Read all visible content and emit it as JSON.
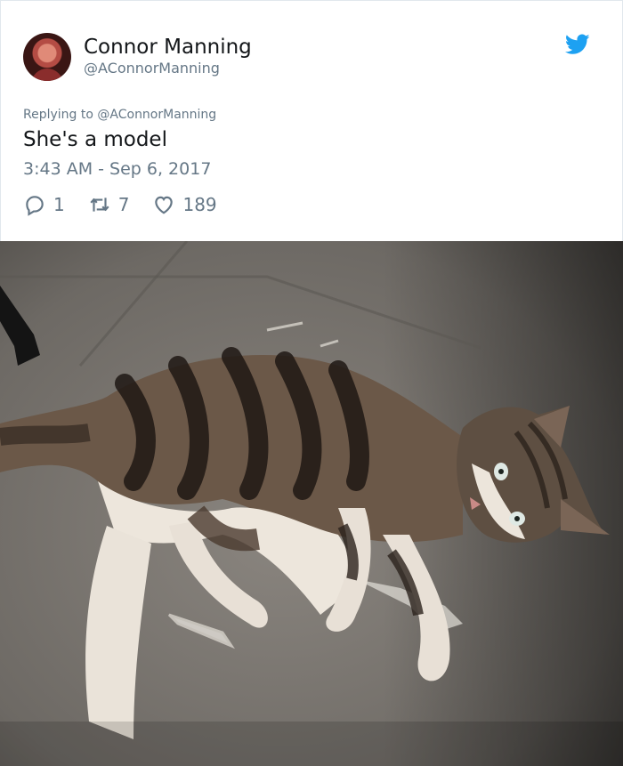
{
  "tweet": {
    "author_name": "Connor Manning",
    "author_handle": "@AConnorManning",
    "replying_to_prefix": "Replying to ",
    "replying_to_handle": "@AConnorManning",
    "text": "She's a model",
    "timestamp": "3:43 AM - Sep 6, 2017",
    "reply_count": "1",
    "retweet_count": "7",
    "like_count": "189"
  },
  "icons": {
    "brand": "twitter-bird-icon",
    "reply": "reply-icon",
    "retweet": "retweet-icon",
    "like": "heart-icon"
  },
  "colors": {
    "twitter_blue": "#1da1f2",
    "secondary_text": "#657786",
    "primary_text": "#14171a",
    "border": "#e1e8ed"
  }
}
